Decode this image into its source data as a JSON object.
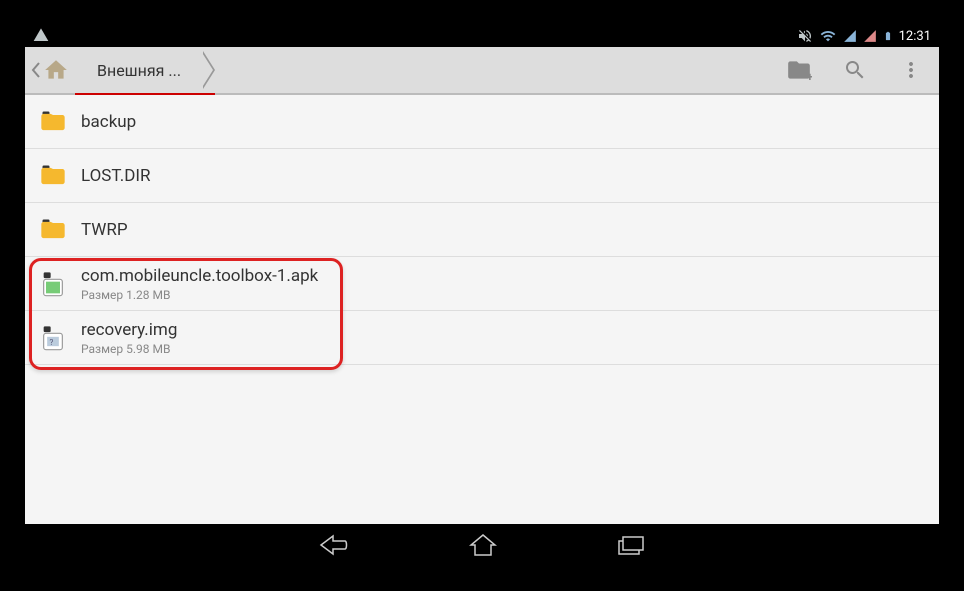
{
  "status": {
    "time": "12:31"
  },
  "breadcrumb": {
    "segment": "Внешняя ..."
  },
  "list": {
    "folders": [
      {
        "name": "backup"
      },
      {
        "name": "LOST.DIR"
      },
      {
        "name": "TWRP"
      }
    ],
    "files": [
      {
        "name": "com.mobileuncle.toolbox-1.apk",
        "size": "Размер 1.28 MB"
      },
      {
        "name": "recovery.img",
        "size": "Размер 5.98 MB"
      }
    ]
  }
}
